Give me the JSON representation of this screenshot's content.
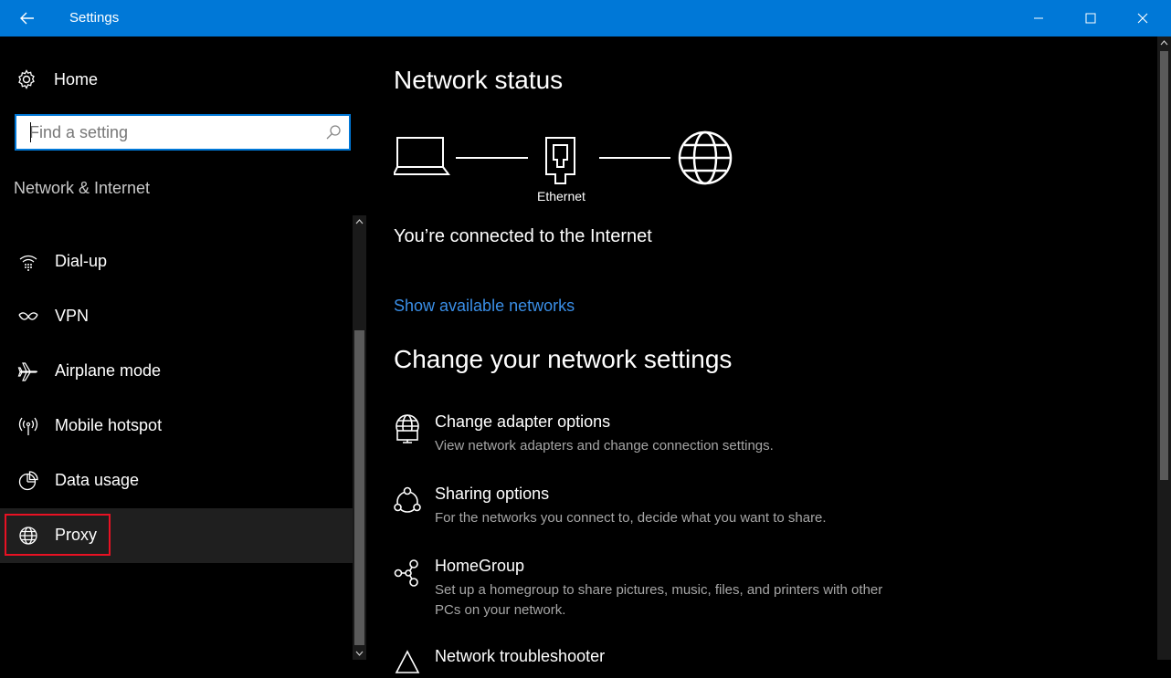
{
  "window": {
    "title": "Settings",
    "accent": "#0078d7"
  },
  "sidebar": {
    "home_label": "Home",
    "search_placeholder": "Find a setting",
    "section_title": "Network & Internet",
    "items": [
      {
        "label": "Dial-up",
        "icon": "dialup-icon"
      },
      {
        "label": "VPN",
        "icon": "vpn-icon"
      },
      {
        "label": "Airplane mode",
        "icon": "airplane-icon"
      },
      {
        "label": "Mobile hotspot",
        "icon": "hotspot-icon"
      },
      {
        "label": "Data usage",
        "icon": "data-usage-icon"
      },
      {
        "label": "Proxy",
        "icon": "globe-icon",
        "selected": true
      }
    ]
  },
  "main": {
    "network_status_title": "Network status",
    "connection_label": "Ethernet",
    "connected_text": "You’re connected to the Internet",
    "show_networks_link": "Show available networks",
    "change_settings_title": "Change your network settings",
    "options": [
      {
        "title": "Change adapter options",
        "desc": "View network adapters and change connection settings.",
        "icon": "adapter-icon"
      },
      {
        "title": "Sharing options",
        "desc": "For the networks you connect to, decide what you want to share.",
        "icon": "sharing-icon"
      },
      {
        "title": "HomeGroup",
        "desc": "Set up a homegroup to share pictures, music, files, and printers with other PCs on your network.",
        "icon": "homegroup-icon"
      },
      {
        "title": "Network troubleshooter",
        "desc": "",
        "icon": "troubleshooter-icon"
      }
    ]
  },
  "colors": {
    "link": "#3a8ee6",
    "highlight_border": "#e81123",
    "selected_bg": "#1f1f1f"
  }
}
